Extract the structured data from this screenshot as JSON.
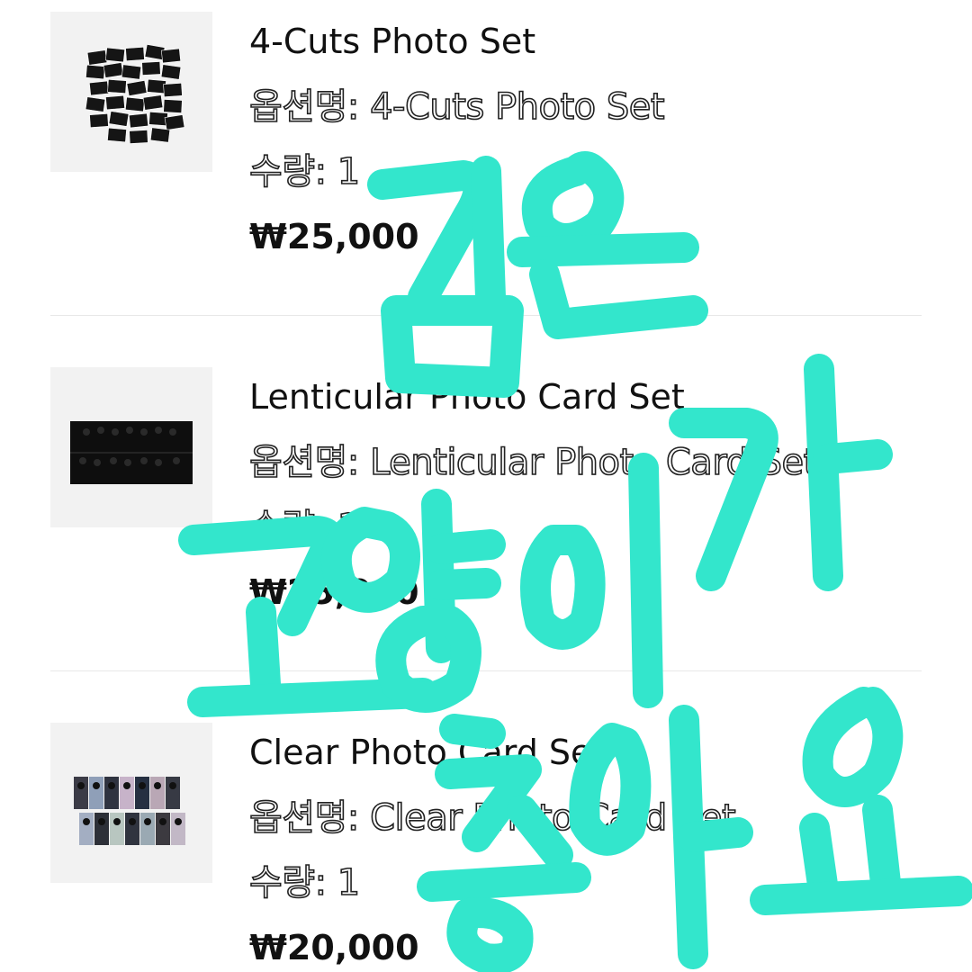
{
  "items": [
    {
      "product_name": "4-Cuts Photo Set",
      "option_prefix": "옵션명: ",
      "option_value": "4-Cuts Photo Set",
      "quantity_prefix": "수량: ",
      "quantity": "1",
      "price": "₩25,000",
      "thumbnail_icon": "photo-cards-scattered-icon"
    },
    {
      "product_name": "Lenticular Photo Card Set",
      "option_prefix": "옵션명: ",
      "option_value": "Lenticular Photo Card Set",
      "quantity_prefix": "수량: ",
      "quantity": "1",
      "price": "₩25,000",
      "thumbnail_icon": "photo-cards-row-icon"
    },
    {
      "product_name": "Clear Photo Card Set",
      "option_prefix": "옵션명: ",
      "option_value": "Clear Photo Card Set",
      "quantity_prefix": "수량: ",
      "quantity": "1",
      "price": "₩20,000",
      "thumbnail_icon": "photo-cards-grid-icon"
    }
  ],
  "overlay": {
    "handwritten_text": "김은 고양이가 좋아요",
    "color": "#33e6cc"
  },
  "colors": {
    "background": "#ffffff",
    "thumbnail_bg": "#f2f2f2",
    "divider": "#e8e8e8",
    "text": "#111111"
  }
}
